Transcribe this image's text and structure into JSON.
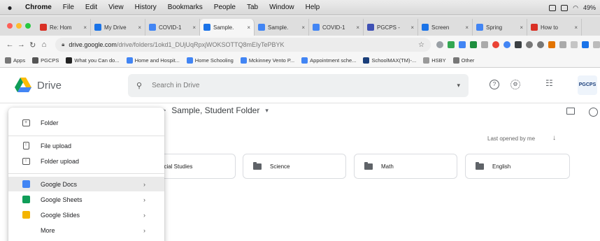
{
  "macos_menu": {
    "app": "Chrome",
    "items": [
      "File",
      "Edit",
      "View",
      "History",
      "Bookmarks",
      "People",
      "Tab",
      "Window",
      "Help"
    ],
    "battery": "49%"
  },
  "tabs": [
    {
      "label": "Re: Hom",
      "color": "#d93025"
    },
    {
      "label": "My Drive",
      "color": "#1a73e8"
    },
    {
      "label": "COVID-1",
      "color": "#4285f4"
    },
    {
      "label": "Sample.",
      "color": "#1a73e8",
      "active": true
    },
    {
      "label": "Sample.",
      "color": "#4285f4"
    },
    {
      "label": "COVID-1",
      "color": "#4285f4"
    },
    {
      "label": "PGCPS -",
      "color": "#3f51b5"
    },
    {
      "label": "Screen",
      "color": "#1a73e8"
    },
    {
      "label": "Spring",
      "color": "#4285f4"
    },
    {
      "label": "How to",
      "color": "#d93025"
    }
  ],
  "address_bar": {
    "url_host": "drive.google.com",
    "url_path": "/drive/folders/1okd1_DUjUqRpxjWOKSOTTQ8mEIyTePBYK"
  },
  "bookmarks": [
    {
      "label": "Apps",
      "color": "#777777"
    },
    {
      "label": "PGCPS",
      "color": "#555555"
    },
    {
      "label": "What you Can do...",
      "color": "#222222"
    },
    {
      "label": "Home and Hospit...",
      "color": "#4285f4"
    },
    {
      "label": "Home Schooling",
      "color": "#4285f4"
    },
    {
      "label": "Mckinney Vento P...",
      "color": "#4285f4"
    },
    {
      "label": "Appointment sche...",
      "color": "#4285f4"
    },
    {
      "label": "SchoolMAX(TM)-...",
      "color": "#1a3e7a"
    },
    {
      "label": "HSBY",
      "color": "#999999"
    },
    {
      "label": "Other",
      "color": "#777777"
    }
  ],
  "drive": {
    "product": "Drive",
    "search_placeholder": "Search in Drive",
    "avatar_text": "PGCPS"
  },
  "breadcrumb": {
    "separator": ">",
    "current_folder": "Sample, Student Folder"
  },
  "sort": {
    "label": "Last opened by me"
  },
  "folders": [
    "ocial Studies",
    "Science",
    "Math",
    "English"
  ],
  "new_menu": {
    "folder": "Folder",
    "file_upload": "File upload",
    "folder_upload": "Folder upload",
    "google_docs": "Google Docs",
    "google_sheets": "Google Sheets",
    "google_slides": "Google Slides",
    "more": "More"
  },
  "colors": {
    "docs": "#4285f4",
    "sheets": "#0f9d58",
    "slides": "#f4b400"
  }
}
